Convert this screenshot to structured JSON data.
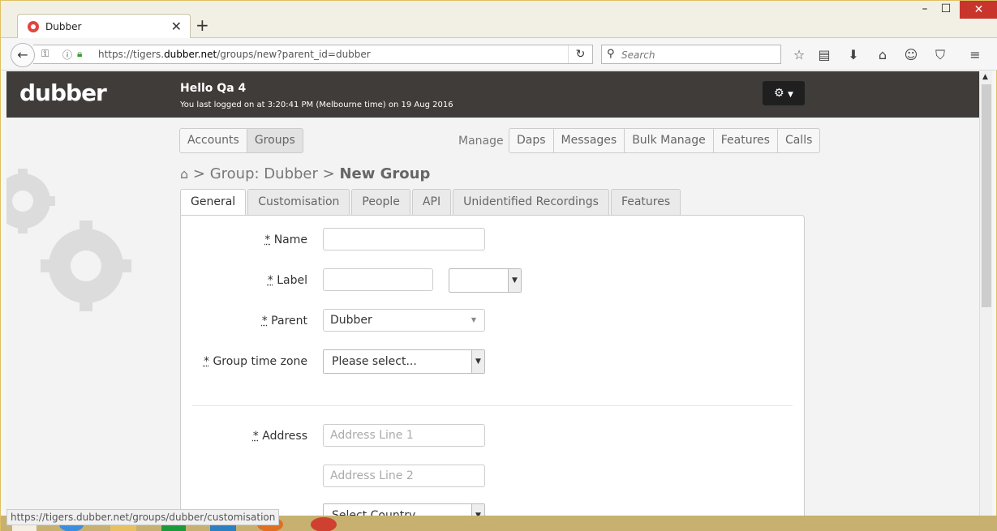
{
  "browser": {
    "tab_title": "Dubber",
    "new_tab": "+",
    "url_host_prefix": "https://tigers.",
    "url_host_bold": "dubber.net",
    "url_path": "/groups/new?parent_id=dubber",
    "search_placeholder": "Search",
    "status_url": "https://tigers.dubber.net/groups/dubber/customisation"
  },
  "header": {
    "logo": "dubber",
    "greeting": "Hello Qa 4",
    "last_logon": "You last logged on at 3:20:41 PM (Melbourne time) on 19 Aug 2016"
  },
  "nav": {
    "left_buttons": [
      "Accounts",
      "Groups"
    ],
    "manage_label": "Manage",
    "right_buttons": [
      "Daps",
      "Messages",
      "Bulk Manage",
      "Features",
      "Calls"
    ]
  },
  "breadcrumb": {
    "separator": ">",
    "parent": "Group: Dubber",
    "current": "New Group"
  },
  "form_tabs": [
    "General",
    "Customisation",
    "People",
    "API",
    "Unidentified Recordings",
    "Features"
  ],
  "form": {
    "required_mark": "*",
    "name_label": "Name",
    "label_label": "Label",
    "parent_label": "Parent",
    "parent_value": "Dubber",
    "timezone_label": "Group time zone",
    "timezone_value": "Please select...",
    "address_label": "Address",
    "address1_placeholder": "Address Line 1",
    "address2_placeholder": "Address Line 2",
    "country_value": "Select Country..."
  },
  "colors": {
    "header_bg": "#403c3a",
    "close_btn": "#c7352d"
  }
}
